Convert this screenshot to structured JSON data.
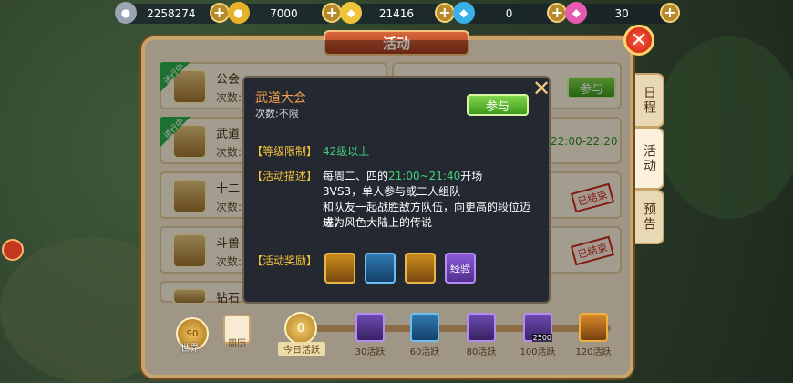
{
  "currencies": [
    {
      "name": "silver",
      "value": "2258274",
      "icon": "silver-coin-icon"
    },
    {
      "name": "gold",
      "value": "7000",
      "icon": "gold-coin-icon"
    },
    {
      "name": "ingot",
      "value": "21416",
      "icon": "gold-ingot-icon"
    },
    {
      "name": "blue-diamond",
      "value": "0",
      "icon": "blue-diamond-icon"
    },
    {
      "name": "pink-diamond",
      "value": "30",
      "icon": "pink-diamond-icon"
    }
  ],
  "panel": {
    "title": "活动",
    "close_icon": "close-x-icon"
  },
  "side_tabs": [
    "日程",
    "活动",
    "预告"
  ],
  "activities": [
    {
      "tag": "进行中",
      "name": "公会",
      "sub": "次数:"
    },
    {
      "tag": "进行中",
      "name": "武道",
      "sub": "次数:"
    },
    {
      "tag": "",
      "name": "十二",
      "sub": "次数:"
    },
    {
      "tag": "",
      "name": "斗兽",
      "sub": "次数:"
    },
    {
      "tag": "",
      "name": "钻石",
      "sub": ""
    }
  ],
  "right_column": {
    "join_label": "参与",
    "time": "22:00-22:20",
    "ended_label": "已结束"
  },
  "popup": {
    "title": "武道大会",
    "count": "次数:不限",
    "join_label": "参与",
    "level_label": "【等级限制】",
    "level_value": "42级以上",
    "desc_label": "【活动描述】",
    "desc_line1_prefix": "每周二、四的",
    "desc_line1_time": "21:00~21:40",
    "desc_line1_suffix": "开场",
    "desc_line2": "3VS3，单人参与或二人组队",
    "desc_line3": "和队友一起战胜敌方队伍，向更高的段位迈进，",
    "desc_line4": "成为风色大陆上的传说",
    "reward_label": "【活动奖励】",
    "rewards": [
      "",
      "",
      "",
      "经验"
    ]
  },
  "bottom": {
    "world_level": "90",
    "world_label": "世界",
    "week_label": "周历",
    "today_value": "0",
    "today_label": "今日活跃",
    "milestones": [
      "30活跃",
      "60活跃",
      "80活跃",
      "100活跃",
      "120活跃"
    ],
    "milestone_badge": "2500"
  }
}
